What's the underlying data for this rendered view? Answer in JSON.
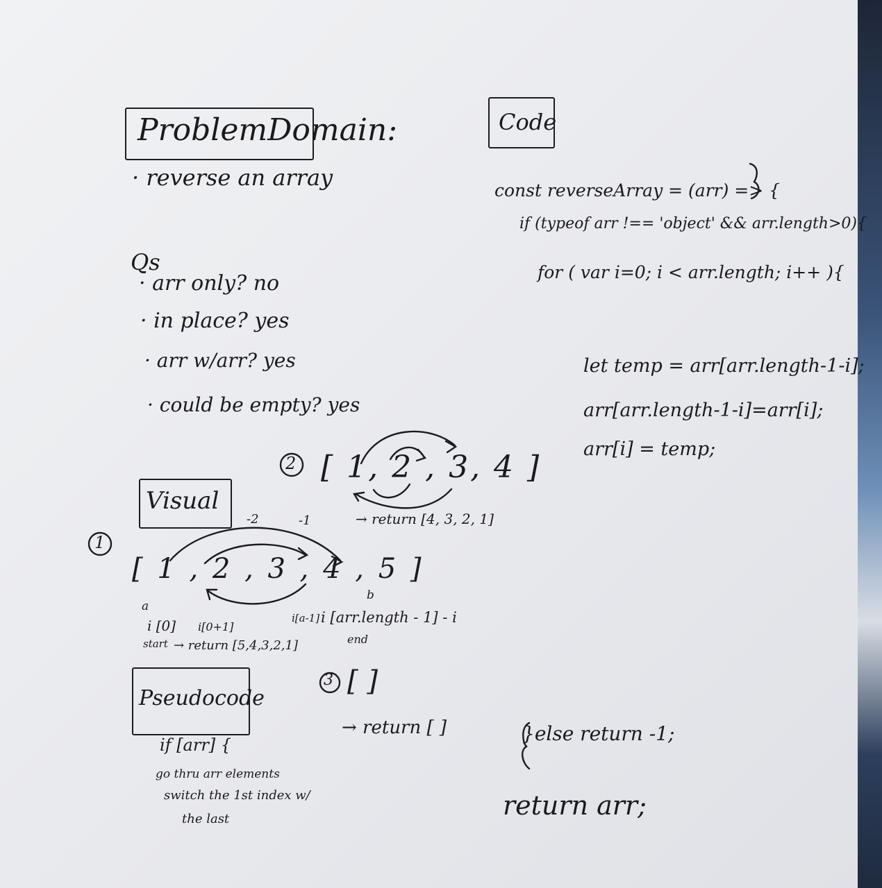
{
  "problem_domain": {
    "title": "ProblemDomain:",
    "task": "· reverse an array"
  },
  "questions": {
    "heading": "Qs",
    "items": [
      "· arr only? no",
      "· in place? yes",
      "· arr w/arr? yes",
      "· could be empty? yes"
    ]
  },
  "code": {
    "title": "Code",
    "lines": [
      "const reverseArray = (arr) => {",
      "if (typeof arr !== 'object' && arr.length>0){",
      "for ( var i=0; i < arr.length; i++ ){",
      "let temp = arr[arr.length-1-i];",
      "arr[arr.length-1-i]=arr[i];",
      "arr[i] = temp;",
      "}else return -1;",
      "return arr;"
    ]
  },
  "visual": {
    "title": "Visual",
    "example1": {
      "marker": "1",
      "array": "[ 1 , 2 , 3 , 4 , 5 ]",
      "neg_labels": [
        "-2",
        "-1"
      ],
      "label_a": "a",
      "label_b": "b",
      "index_start": "i [0]",
      "index_next": "i[0+1]",
      "index_prev": "i[a-1]",
      "index_end": "i [arr.length - 1] - i",
      "start": "start",
      "end": "end",
      "result": "→ return [5,4,3,2,1]"
    },
    "example2": {
      "marker": "2",
      "array": "[ 1, 2 , 3, 4 ]",
      "result": "→ return [4, 3, 2, 1]"
    },
    "example3": {
      "marker": "3",
      "array": "[ ]",
      "result": "→ return [ ]"
    }
  },
  "pseudocode": {
    "title": "Pseudocode",
    "lines": [
      "if [arr] {",
      "go thru arr elements",
      "switch the 1st index w/",
      "the last"
    ]
  }
}
